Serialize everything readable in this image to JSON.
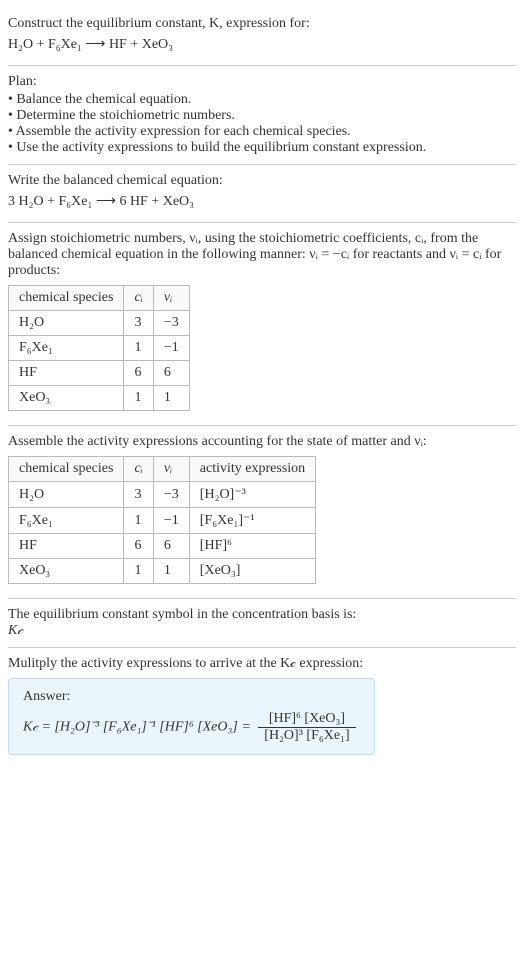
{
  "intro": {
    "line1": "Construct the equilibrium constant, K, expression for:",
    "eq": "H₂O + F₆Xe₁ ⟶ HF + XeO₃"
  },
  "plan": {
    "title": "Plan:",
    "items": [
      "• Balance the chemical equation.",
      "• Determine the stoichiometric numbers.",
      "• Assemble the activity expression for each chemical species.",
      "• Use the activity expressions to build the equilibrium constant expression."
    ]
  },
  "balanced": {
    "title": "Write the balanced chemical equation:",
    "eq": "3 H₂O + F₆Xe₁ ⟶ 6 HF + XeO₃"
  },
  "stoich": {
    "text": "Assign stoichiometric numbers, νᵢ, using the stoichiometric coefficients, cᵢ, from the balanced chemical equation in the following manner: νᵢ = −cᵢ for reactants and νᵢ = cᵢ for products:",
    "headers": {
      "h1": "chemical species",
      "h2": "cᵢ",
      "h3": "νᵢ"
    },
    "rows": [
      {
        "sp": "H₂O",
        "c": "3",
        "v": "−3"
      },
      {
        "sp": "F₆Xe₁",
        "c": "1",
        "v": "−1"
      },
      {
        "sp": "HF",
        "c": "6",
        "v": "6"
      },
      {
        "sp": "XeO₃",
        "c": "1",
        "v": "1"
      }
    ]
  },
  "activity": {
    "text": "Assemble the activity expressions accounting for the state of matter and νᵢ:",
    "headers": {
      "h1": "chemical species",
      "h2": "cᵢ",
      "h3": "νᵢ",
      "h4": "activity expression"
    },
    "rows": [
      {
        "sp": "H₂O",
        "c": "3",
        "v": "−3",
        "a": "[H₂O]⁻³"
      },
      {
        "sp": "F₆Xe₁",
        "c": "1",
        "v": "−1",
        "a": "[F₆Xe₁]⁻¹"
      },
      {
        "sp": "HF",
        "c": "6",
        "v": "6",
        "a": "[HF]⁶"
      },
      {
        "sp": "XeO₃",
        "c": "1",
        "v": "1",
        "a": "[XeO₃]"
      }
    ]
  },
  "symbol": {
    "line1": "The equilibrium constant symbol in the concentration basis is:",
    "line2": "K𝒸"
  },
  "multiply": {
    "text": "Mulitply the activity expressions to arrive at the K𝒸 expression:"
  },
  "answer": {
    "label": "Answer:",
    "lhs": "K𝒸 = [H₂O]⁻³ [F₆Xe₁]⁻¹ [HF]⁶ [XeO₃] = ",
    "num": "[HF]⁶ [XeO₃]",
    "den": "[H₂O]³ [F₆Xe₁]"
  }
}
